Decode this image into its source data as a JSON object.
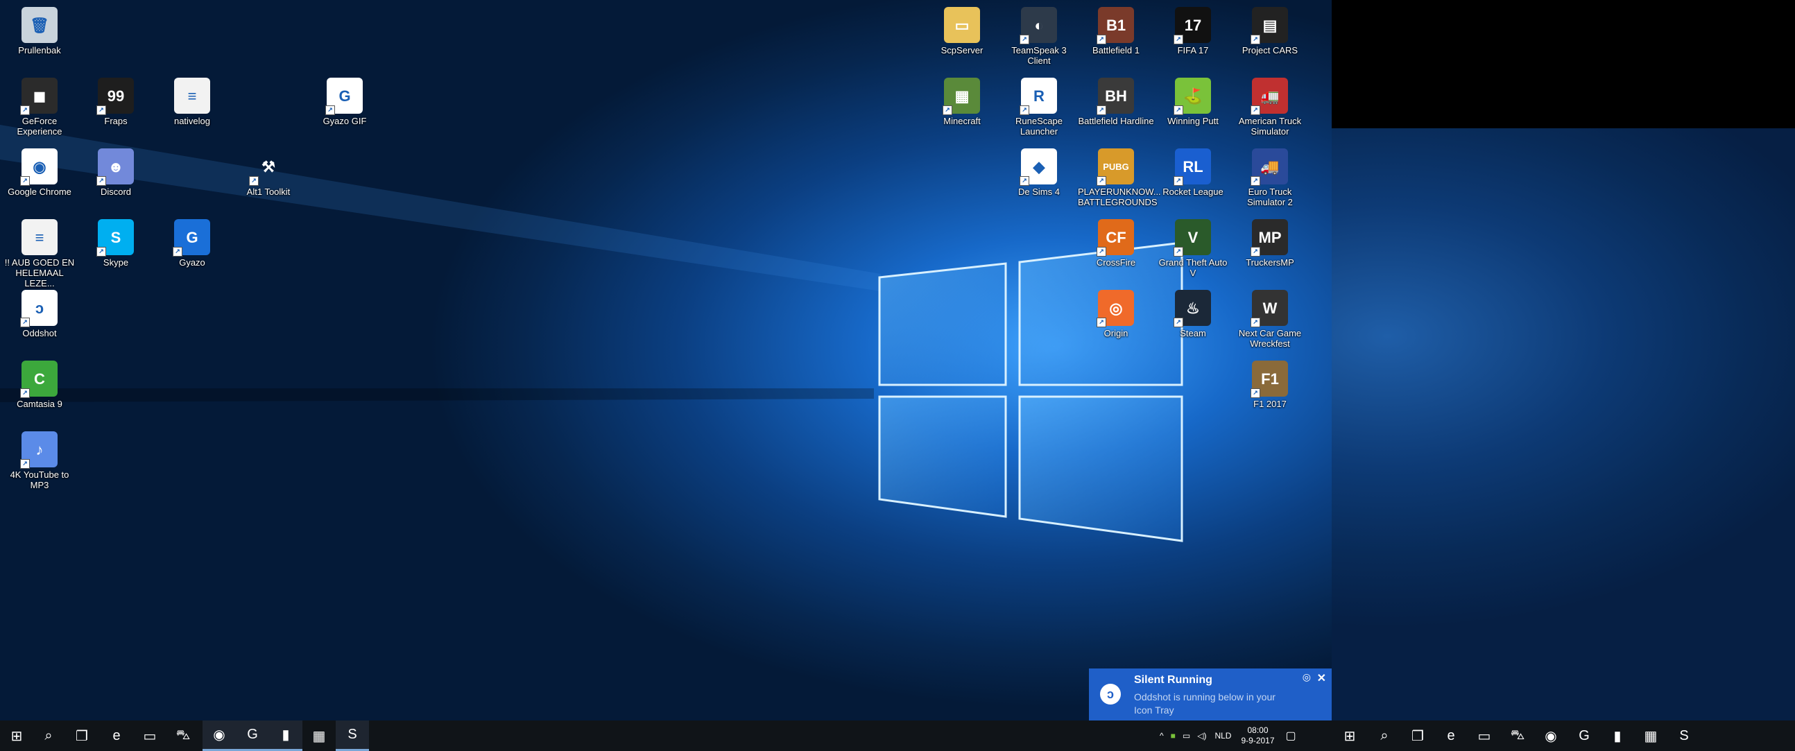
{
  "desktop_left": {
    "icons": [
      {
        "label": "Prullenbak",
        "icon": "recycle-bin-icon",
        "color": "#c9d3dc",
        "glyph": "🗑"
      },
      {
        "label": "GeForce Experience",
        "icon": "geforce-icon",
        "color": "#2b2b2b",
        "glyph": "◼"
      },
      {
        "label": "Fraps",
        "icon": "fraps-icon",
        "color": "#1e1e1e",
        "glyph": "99"
      },
      {
        "label": "nativelog",
        "icon": "text-file-icon",
        "color": "#f2f2f2",
        "glyph": "≡"
      },
      {
        "label": "Gyazo GIF",
        "icon": "gyazo-gif-icon",
        "color": "#ffffff",
        "glyph": "G"
      },
      {
        "label": "Google Chrome",
        "icon": "chrome-icon",
        "color": "#ffffff",
        "glyph": "◉"
      },
      {
        "label": "Discord",
        "icon": "discord-icon",
        "color": "#7289da",
        "glyph": "☻"
      },
      {
        "label": "Alt1 Toolkit",
        "icon": "pickaxe-icon",
        "color": "transparent",
        "glyph": "⚒"
      },
      {
        "label": "!! AUB GOED EN HELEMAAL LEZE...",
        "icon": "document-icon",
        "color": "#f2f2f2",
        "glyph": "≡"
      },
      {
        "label": "Skype",
        "icon": "skype-icon",
        "color": "#00aff0",
        "glyph": "S"
      },
      {
        "label": "Gyazo",
        "icon": "gyazo-icon",
        "color": "#1a6fd8",
        "glyph": "G"
      },
      {
        "label": "Oddshot",
        "icon": "oddshot-icon",
        "color": "#ffffff",
        "glyph": "ↄ"
      },
      {
        "label": "Camtasia 9",
        "icon": "camtasia-icon",
        "color": "#3ca83c",
        "glyph": "C"
      },
      {
        "label": "4K YouTube to MP3",
        "icon": "youtube-mp3-icon",
        "color": "#5b8be8",
        "glyph": "♪"
      }
    ]
  },
  "desktop_right": {
    "icons": [
      {
        "label": "ScpServer",
        "icon": "folder-icon",
        "color": "#e8c25a",
        "glyph": "▭"
      },
      {
        "label": "TeamSpeak 3 Client",
        "icon": "teamspeak-icon",
        "color": "#2d3a4a",
        "glyph": "◐"
      },
      {
        "label": "Battlefield 1",
        "icon": "battlefield1-icon",
        "color": "#7a3a2a",
        "glyph": "B1"
      },
      {
        "label": "FIFA 17",
        "icon": "fifa17-icon",
        "color": "#111111",
        "glyph": "17"
      },
      {
        "label": "Project CARS",
        "icon": "project-cars-icon",
        "color": "#222222",
        "glyph": "▤"
      },
      {
        "label": "Minecraft",
        "icon": "minecraft-icon",
        "color": "#5a8a3a",
        "glyph": "▦"
      },
      {
        "label": "RuneScape Launcher",
        "icon": "runescape-icon",
        "color": "#ffffff",
        "glyph": "R"
      },
      {
        "label": "Battlefield Hardline",
        "icon": "bf-hardline-icon",
        "color": "#3a3a3a",
        "glyph": "BH"
      },
      {
        "label": "Winning Putt",
        "icon": "winning-putt-icon",
        "color": "#7ac23a",
        "glyph": "⛳"
      },
      {
        "label": "American Truck Simulator",
        "icon": "ats-icon",
        "color": "#c03030",
        "glyph": "🚛"
      },
      {
        "label": "De Sims 4",
        "icon": "sims4-icon",
        "color": "#ffffff",
        "glyph": "◆"
      },
      {
        "label": "PLAYERUNKNOW... BATTLEGROUNDS",
        "icon": "pubg-icon",
        "color": "#d89a2a",
        "glyph": "PUBG"
      },
      {
        "label": "Rocket League",
        "icon": "rocket-league-icon",
        "color": "#1a5fd0",
        "glyph": "RL"
      },
      {
        "label": "Euro Truck Simulator 2",
        "icon": "ets2-icon",
        "color": "#2a4a9a",
        "glyph": "🚚"
      },
      {
        "label": "CrossFire",
        "icon": "crossfire-icon",
        "color": "#e06a1a",
        "glyph": "CF"
      },
      {
        "label": "Grand Theft Auto V",
        "icon": "gta5-icon",
        "color": "#2a5a2a",
        "glyph": "V"
      },
      {
        "label": "TruckersMP",
        "icon": "truckersmp-icon",
        "color": "#2a2a2a",
        "glyph": "MP"
      },
      {
        "label": "Origin",
        "icon": "origin-icon",
        "color": "#f06a2a",
        "glyph": "◎"
      },
      {
        "label": "Steam",
        "icon": "steam-icon",
        "color": "#1b2838",
        "glyph": "♨"
      },
      {
        "label": "Next Car Game Wreckfest",
        "icon": "wreckfest-icon",
        "color": "#333333",
        "glyph": "W"
      },
      {
        "label": "F1 2017",
        "icon": "f1-2017-icon",
        "color": "#8a6a3a",
        "glyph": "F1"
      }
    ]
  },
  "taskbar": {
    "apps": [
      {
        "name": "start-button",
        "glyph": "⊞"
      },
      {
        "name": "search-icon",
        "glyph": "⌕"
      },
      {
        "name": "task-view-icon",
        "glyph": "❐"
      },
      {
        "name": "edge-icon",
        "glyph": "e"
      },
      {
        "name": "file-explorer-icon",
        "glyph": "▭"
      },
      {
        "name": "store-icon",
        "glyph": "⛍"
      },
      {
        "name": "chrome-taskbar-icon",
        "glyph": "◉"
      },
      {
        "name": "gyazo-taskbar-icon",
        "glyph": "G"
      },
      {
        "name": "audio-meter-icon",
        "glyph": "▮"
      },
      {
        "name": "calculator-icon",
        "glyph": "▦"
      },
      {
        "name": "skype-taskbar-icon",
        "glyph": "S"
      }
    ],
    "tray": {
      "language": "NLD",
      "time": "08:00",
      "date": "9-9-2017"
    }
  },
  "toast": {
    "title": "Silent Running",
    "body": "Oddshot is running below in your Icon Tray"
  },
  "colors": {
    "toast_bg": "#1f5fc8",
    "taskbar_bg": "#101418"
  }
}
